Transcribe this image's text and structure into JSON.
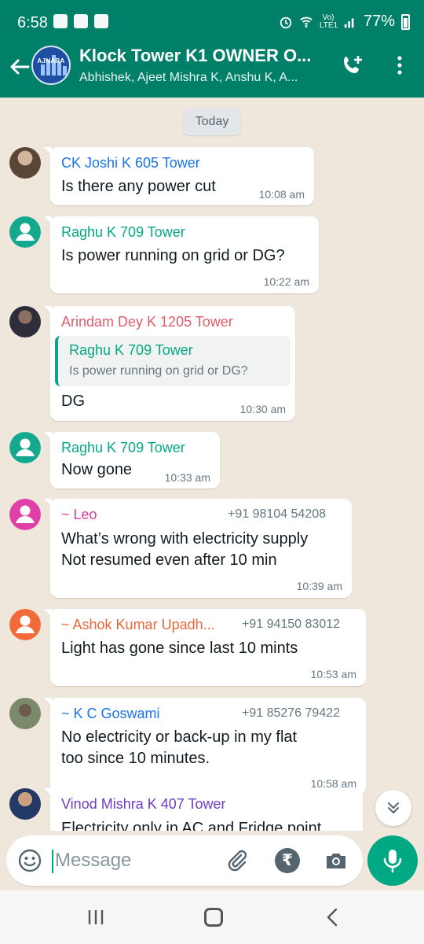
{
  "status_bar": {
    "time": "6:58",
    "battery": "77%",
    "network": "Vo) LTE1"
  },
  "header": {
    "title": "Klock Tower K1 OWNER O...",
    "subtitle": "Abhishek, Ajeet Mishra K, Anshu K, A...",
    "avatar_text": "AJNARA"
  },
  "chat": {
    "date_label": "Today",
    "messages": [
      {
        "sender": "CK Joshi K 605 Tower",
        "sender_color": "#1a73e8",
        "text": "Is there any power cut",
        "time": "10:08 am"
      },
      {
        "sender": "Raghu K 709 Tower",
        "sender_color": "#06a884",
        "text": "Is power running on grid or DG?",
        "time": "10:22 am"
      },
      {
        "sender": "Arindam Dey K 1205 Tower",
        "sender_color": "#e05c6b",
        "quoted_sender": "Raghu K 709 Tower",
        "quoted_text": "Is power running on grid or DG?",
        "text": "DG",
        "time": "10:30 am"
      },
      {
        "sender": "Raghu K 709 Tower",
        "sender_color": "#06a884",
        "text": "Now gone",
        "time": "10:33 am"
      },
      {
        "sender": "~ Leo",
        "sender_color": "#d63fa0",
        "phone": "+91 98104 54208",
        "lines": [
          "What’s wrong with electricity supply",
          "Not resumed even after 10 min"
        ],
        "time": "10:39 am"
      },
      {
        "sender": "~ Ashok Kumar Upadh...",
        "sender_color": "#e8683a",
        "phone": "+91 94150 83012",
        "text": "Light has gone since last 10 mints",
        "time": "10:53 am"
      },
      {
        "sender": "~ K C Goswami",
        "sender_color": "#1a73e8",
        "phone": "+91 85276 79422",
        "lines": [
          "No electricity or back-up in my flat",
          "too since 10 minutes."
        ],
        "time": "10:58 am"
      },
      {
        "sender": "Vinod Mishra K 407 Tower",
        "sender_color": "#6a3fc4",
        "text": "Electricity only in AC and Fridge point"
      }
    ]
  },
  "composer": {
    "placeholder": "Message"
  },
  "colors": {
    "header": "#008069",
    "accent": "#00a884",
    "chat_bg": "#efe7dc"
  },
  "icons": [
    "back-arrow-icon",
    "add-call-icon",
    "menu-dots-icon",
    "emoji-icon",
    "attach-icon",
    "rupee-icon",
    "camera-icon",
    "mic-icon",
    "scroll-down-icon"
  ]
}
